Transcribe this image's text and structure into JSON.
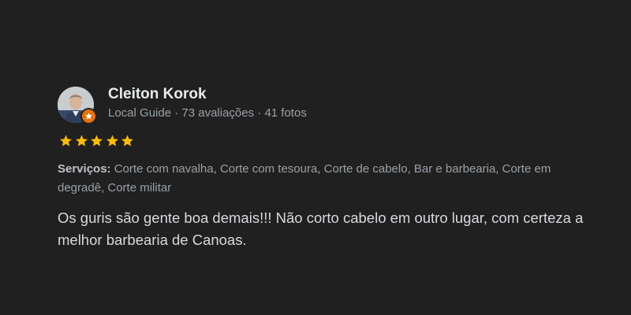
{
  "review": {
    "author": {
      "name": "Cleiton Korok",
      "meta": "Local Guide · 73 avaliações · 41 fotos",
      "avatar_icon": "user-photo-icon",
      "badge_icon": "local-guide-star-icon"
    },
    "rating": 5,
    "rating_max": 5,
    "star_color": "#fbbc04",
    "services": {
      "label": "Serviços:",
      "value": "Corte com navalha, Corte com tesoura, Corte de cabelo, Bar e barbearia, Corte em degradê, Corte militar"
    },
    "text": "Os guris são gente boa demais!!! Não corto cabelo em outro lugar, com certeza a melhor barbearia de Canoas."
  }
}
